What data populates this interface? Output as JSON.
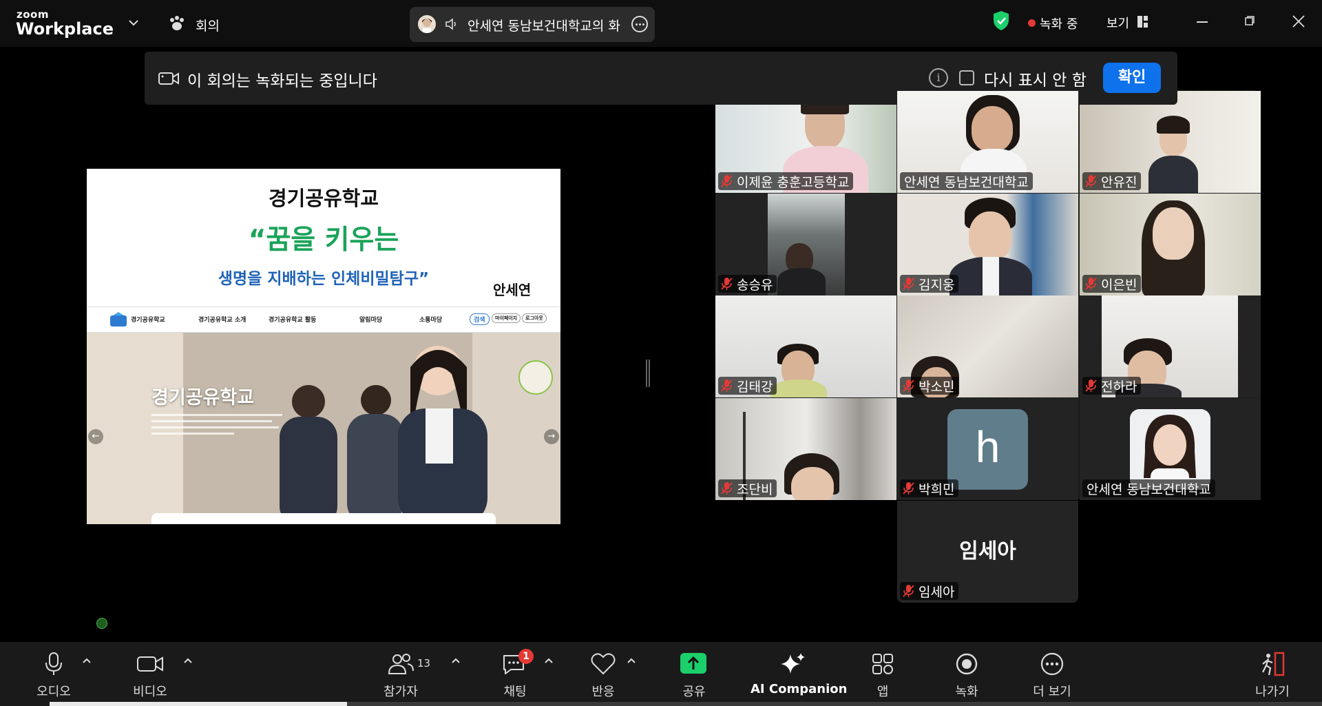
{
  "app": {
    "brand_top": "zoom",
    "brand_bottom": "Workplace",
    "meeting_label": "회의",
    "speaker_pill_text": "안세연 동남보건대학교의 화",
    "recording_text": "녹화 중",
    "view_label": "보기"
  },
  "banner": {
    "message": "이 회의는 녹화되는 중입니다",
    "dont_show": "다시 표시 안 함",
    "ok": "확인",
    "info": "i"
  },
  "slide": {
    "title": "경기공유학교",
    "headline": "“꿈을 키우는",
    "subtitle": "생명을 지배하는 인체비밀탐구”",
    "author": "안세연",
    "nav": [
      "경기공유학교",
      "경기공유학교 소개",
      "경기공유학교 활동",
      "알림마당",
      "소통마당",
      "검색",
      "마이페이지",
      "로그아웃"
    ],
    "hero_title": "경기공유학교",
    "arrow_left": "←",
    "arrow_right": "→"
  },
  "participants": [
    {
      "name": "이제윤 충훈고등학교",
      "muted": true
    },
    {
      "name": "안세연 동남보건대학교",
      "muted": false,
      "active": true
    },
    {
      "name": "안유진",
      "muted": true
    },
    {
      "name": "송승유",
      "muted": true
    },
    {
      "name": "김지웅",
      "muted": true
    },
    {
      "name": "이은빈",
      "muted": true
    },
    {
      "name": "김태강",
      "muted": true
    },
    {
      "name": "박소민",
      "muted": true
    },
    {
      "name": "전하라",
      "muted": true
    },
    {
      "name": "조단비",
      "muted": true
    },
    {
      "name": "박희민",
      "muted": true,
      "avatar_letter": "h"
    },
    {
      "name": "안세연 동남보건대학교",
      "muted": false
    },
    {
      "name": "임세아",
      "muted": true,
      "big_label": "임세아"
    }
  ],
  "toolbar": {
    "audio": "오디오",
    "video": "비디오",
    "participants": "참가자",
    "participants_count": "13",
    "chat": "채팅",
    "chat_badge": "1",
    "reactions": "반응",
    "share": "공유",
    "ai": "AI Companion",
    "apps": "앱",
    "record": "녹화",
    "more": "더 보기",
    "leave": "나가기"
  },
  "colors": {
    "accent_blue": "#0e72ed",
    "share_green": "#1bd06a",
    "active_speaker": "#2ecc71",
    "recording_red": "#e53935",
    "muted_red": "#e53935"
  }
}
